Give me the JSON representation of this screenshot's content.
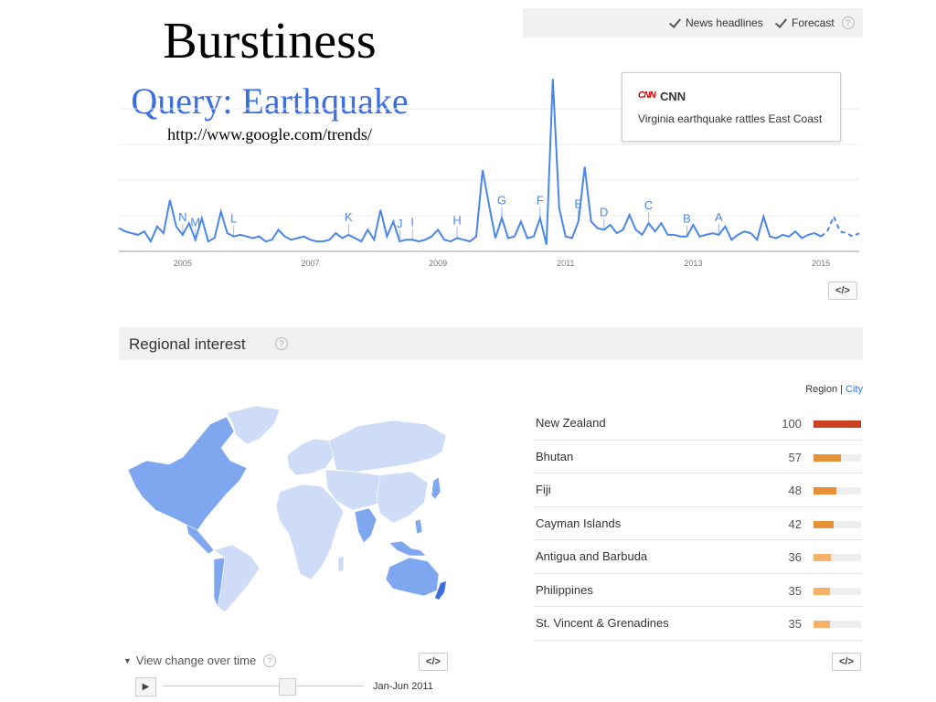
{
  "slide": {
    "title": "Burstiness",
    "subtitle": "Query: Earthquake",
    "url": "http://www.google.com/trends/"
  },
  "options": {
    "news_headlines": "News headlines",
    "forecast": "Forecast",
    "help": "?"
  },
  "news_card": {
    "logo": "CNN",
    "source": "CNN",
    "headline": "Virginia earthquake rattles East Coast"
  },
  "colors": {
    "line": "#4a86e8",
    "marker_label": "#4a86e8",
    "bar_top": "#cc4125",
    "bar_mid": "#e69138",
    "bar_low": "#f6b26b",
    "map_high": "#7fa7ef",
    "map_low": "#cfdcf8",
    "map_nz": "#3b6fe0"
  },
  "chart_data": [
    {
      "type": "line",
      "title": "",
      "xlabel": "",
      "ylabel": "",
      "xlim": [
        2004,
        2015.6
      ],
      "ylim": [
        0,
        100
      ],
      "x_ticks": [
        "2005",
        "2007",
        "2009",
        "2011",
        "2013",
        "2015"
      ],
      "x_tick_values": [
        2005,
        2007,
        2009,
        2011,
        2013,
        2015
      ],
      "forecast_start": 2015.0,
      "series": [
        {
          "x": [
            2004.0,
            2004.1,
            2004.2,
            2004.3,
            2004.4,
            2004.5,
            2004.6,
            2004.7,
            2004.8,
            2004.9,
            2005.0,
            2005.1,
            2005.2,
            2005.3,
            2005.4,
            2005.5,
            2005.6,
            2005.7,
            2005.8,
            2005.9,
            2006.0,
            2006.1,
            2006.2,
            2006.3,
            2006.4,
            2006.5,
            2006.6,
            2006.7,
            2006.8,
            2006.9,
            2007.0,
            2007.1,
            2007.2,
            2007.3,
            2007.4,
            2007.5,
            2007.6,
            2007.7,
            2007.8,
            2007.9,
            2008.0,
            2008.1,
            2008.2,
            2008.3,
            2008.4,
            2008.5,
            2008.6,
            2008.7,
            2008.8,
            2008.9,
            2009.0,
            2009.1,
            2009.2,
            2009.3,
            2009.4,
            2009.5,
            2009.6,
            2009.7,
            2009.8,
            2009.9,
            2010.0,
            2010.1,
            2010.2,
            2010.3,
            2010.4,
            2010.5,
            2010.6,
            2010.7,
            2010.8,
            2010.9,
            2011.0,
            2011.1,
            2011.2,
            2011.3,
            2011.4,
            2011.5,
            2011.6,
            2011.7,
            2011.8,
            2011.9,
            2012.0,
            2012.1,
            2012.2,
            2012.3,
            2012.4,
            2012.5,
            2012.6,
            2012.7,
            2012.8,
            2012.9,
            2013.0,
            2013.1,
            2013.2,
            2013.3,
            2013.4,
            2013.5,
            2013.6,
            2013.7,
            2013.8,
            2013.9,
            2014.0,
            2014.1,
            2014.2,
            2014.3,
            2014.4,
            2014.5,
            2014.6,
            2014.7,
            2014.8,
            2014.9,
            2015.0,
            2015.1,
            2015.2,
            2015.3,
            2015.4,
            2015.5,
            2015.6
          ],
          "values": [
            14,
            12,
            11,
            10,
            12,
            6,
            15,
            11,
            31,
            15,
            10,
            17,
            7,
            20,
            6,
            8,
            24,
            11,
            9,
            10,
            9,
            8,
            9,
            6,
            7,
            13,
            9,
            7,
            8,
            9,
            7,
            6,
            6,
            7,
            11,
            8,
            10,
            8,
            6,
            13,
            7,
            25,
            9,
            18,
            6,
            7,
            7,
            6,
            7,
            9,
            13,
            7,
            6,
            8,
            7,
            6,
            9,
            49,
            28,
            8,
            20,
            8,
            9,
            18,
            8,
            9,
            20,
            4,
            104,
            26,
            9,
            8,
            18,
            51,
            18,
            14,
            13,
            16,
            11,
            13,
            22,
            13,
            10,
            17,
            12,
            17,
            10,
            10,
            9,
            9,
            16,
            9,
            10,
            11,
            10,
            15,
            7,
            10,
            12,
            11,
            7,
            21,
            9,
            8,
            10,
            9,
            12,
            8,
            10,
            11,
            9,
            12,
            21,
            12,
            11,
            9,
            11
          ]
        }
      ],
      "annotations": [
        {
          "label": "N",
          "x": 2005.0
        },
        {
          "label": "M",
          "x": 2005.2
        },
        {
          "label": "L",
          "x": 2005.8
        },
        {
          "label": "K",
          "x": 2007.6
        },
        {
          "label": "J",
          "x": 2008.4
        },
        {
          "label": "I",
          "x": 2008.6
        },
        {
          "label": "H",
          "x": 2009.3
        },
        {
          "label": "G",
          "x": 2010.0
        },
        {
          "label": "F",
          "x": 2010.6
        },
        {
          "label": "E",
          "x": 2011.2
        },
        {
          "label": "D",
          "x": 2011.6
        },
        {
          "label": "C",
          "x": 2012.3
        },
        {
          "label": "B",
          "x": 2012.9
        },
        {
          "label": "A",
          "x": 2013.4
        }
      ]
    },
    {
      "type": "bar",
      "title": "Regional interest",
      "toggle": {
        "region": "Region",
        "separator": "|",
        "city": "City"
      },
      "categories": [
        "New Zealand",
        "Bhutan",
        "Fiji",
        "Cayman Islands",
        "Antigua and Barbuda",
        "Philippines",
        "St. Vincent & Grenadines"
      ],
      "values": [
        100,
        57,
        48,
        42,
        36,
        35,
        35
      ],
      "ylim": [
        0,
        100
      ]
    }
  ],
  "time_control": {
    "toggle_label": "View change over time",
    "help": "?",
    "range_label": "Jan-Jun 2011",
    "play_icon": "▶",
    "position": 0.62
  },
  "embed_label": "</>"
}
